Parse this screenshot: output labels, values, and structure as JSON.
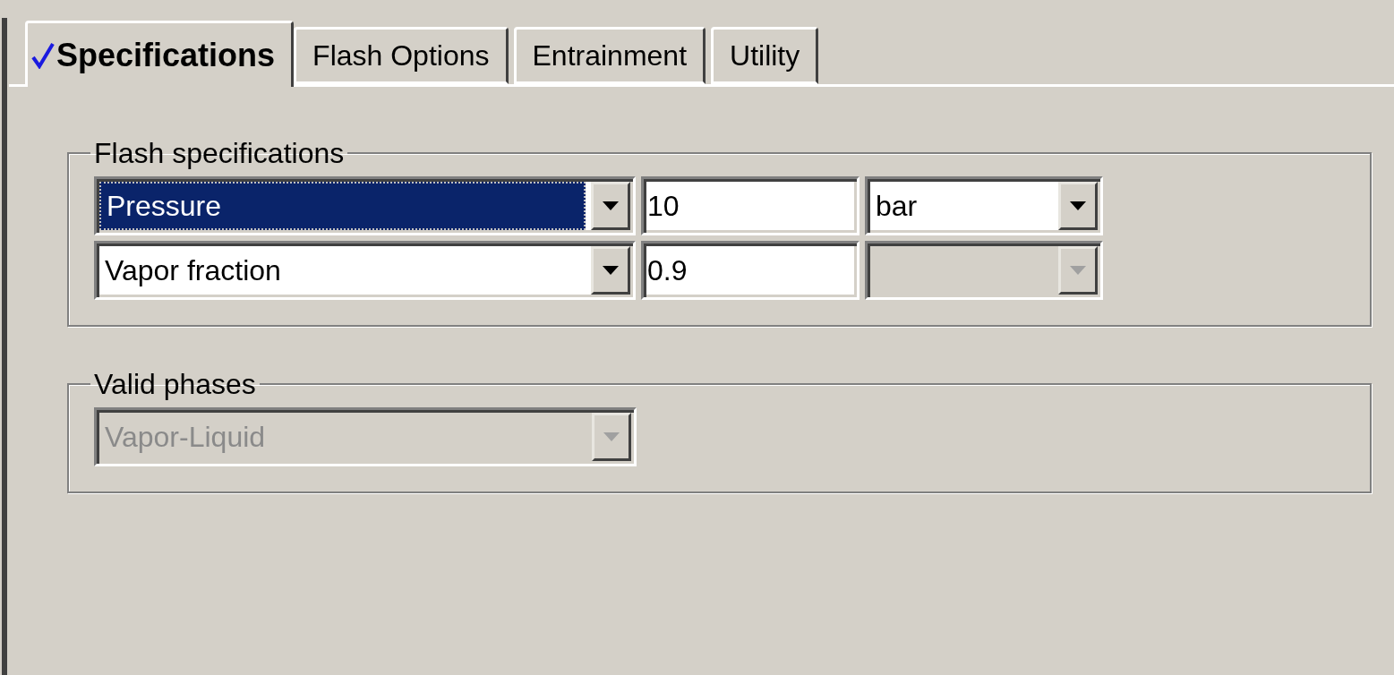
{
  "tabs": [
    {
      "label": "Specifications",
      "selected": true,
      "complete": true
    },
    {
      "label": "Flash Options",
      "selected": false,
      "complete": false
    },
    {
      "label": "Entrainment",
      "selected": false,
      "complete": false
    },
    {
      "label": "Utility",
      "selected": false,
      "complete": false
    }
  ],
  "flash_specifications": {
    "title": "Flash specifications",
    "rows": [
      {
        "spec": {
          "value": "Pressure",
          "focused": true
        },
        "value": "10",
        "unit": {
          "value": "bar",
          "disabled": false
        }
      },
      {
        "spec": {
          "value": "Vapor fraction",
          "focused": false
        },
        "value": "0.9",
        "unit": {
          "disabled": true
        }
      }
    ]
  },
  "valid_phases": {
    "title": "Valid phases",
    "value": "Vapor-Liquid",
    "disabled": true
  }
}
